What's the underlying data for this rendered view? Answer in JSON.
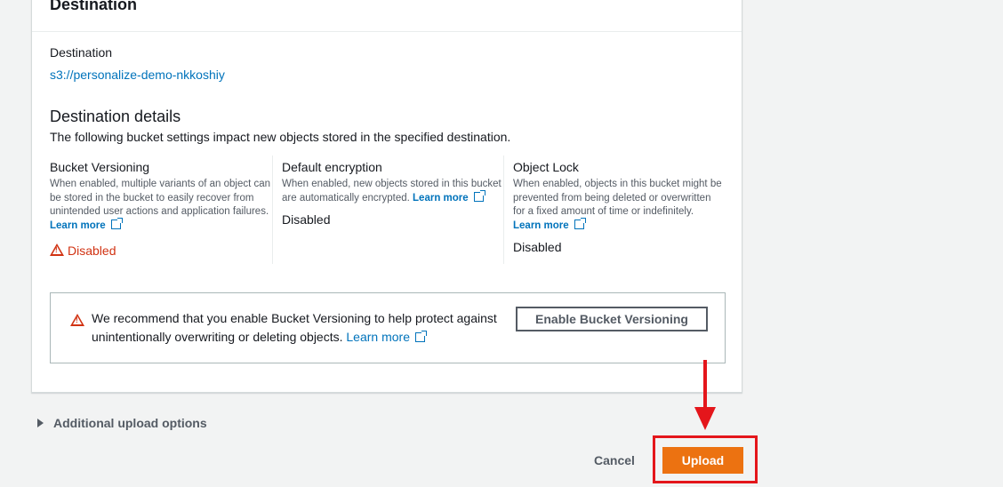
{
  "panel": {
    "title": "Destination"
  },
  "destination": {
    "label": "Destination",
    "link": "s3://personalize-demo-nkkoshiy"
  },
  "details": {
    "heading": "Destination details",
    "description": "The following bucket settings impact new objects stored in the specified destination.",
    "settings": [
      {
        "title": "Bucket Versioning",
        "desc": "When enabled, multiple variants of an object can be stored in the bucket to easily recover from unintended user actions and application failures.",
        "learn": "Learn more",
        "status": "Disabled"
      },
      {
        "title": "Default encryption",
        "desc": "When enabled, new objects stored in this bucket are automatically encrypted.",
        "learn": "Learn more",
        "status": "Disabled"
      },
      {
        "title": "Object Lock",
        "desc": "When enabled, objects in this bucket might be prevented from being deleted or overwritten for a fixed amount of time or indefinitely.",
        "learn": "Learn more",
        "status": "Disabled"
      }
    ]
  },
  "alert": {
    "text": "We recommend that you enable Bucket Versioning to help protect against unintentionally overwriting or deleting objects.",
    "learn": "Learn more",
    "button": "Enable Bucket Versioning"
  },
  "additional_options": {
    "label": "Additional upload options"
  },
  "footer": {
    "cancel": "Cancel",
    "upload": "Upload"
  },
  "colors": {
    "link": "#0073bb",
    "error": "#d13212",
    "primary": "#ec7211",
    "annotation": "#e4161b"
  }
}
